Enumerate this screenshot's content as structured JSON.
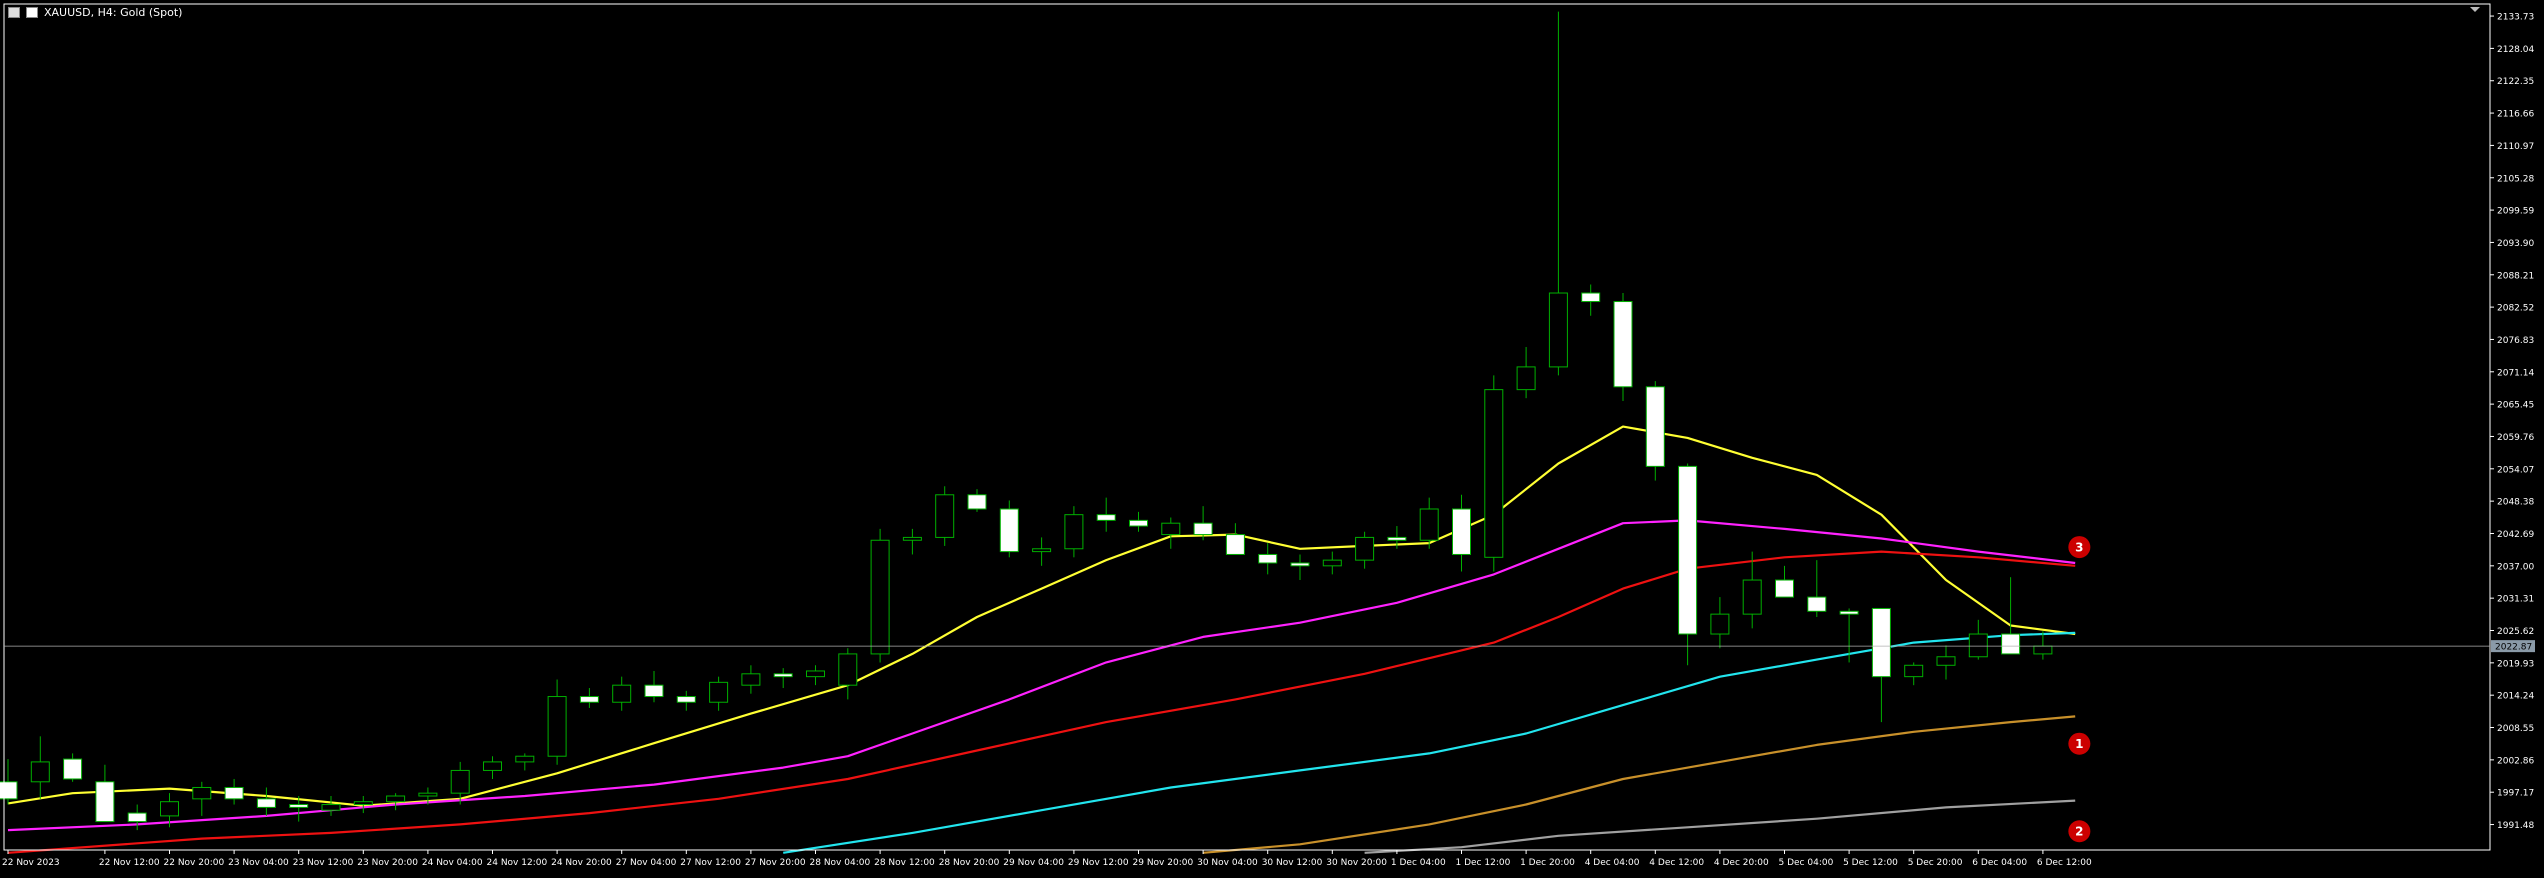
{
  "window": {
    "title": "XAUUSD, H4:  Gold (Spot)"
  },
  "current_price_label": "2022.87",
  "colors": {
    "background": "#000000",
    "axis": "#ffffff",
    "bull_body": "#000000",
    "bull_border": "#00b000",
    "bear_body": "#ffffff",
    "bear_border": "#00b000",
    "ma_yellow": "#ffff33",
    "ma_magenta": "#ff22ff",
    "ma_red": "#ee1111",
    "ma_cyan": "#22e5ee",
    "ma_orange": "#c8902a",
    "ma_gray": "#a0a0a0",
    "current_price_line": "#b0b0b0",
    "current_price_tag": "#8a9aa8",
    "marker": "#cc0000"
  },
  "chart_data": {
    "type": "candlestick",
    "symbol": "XAUUSD",
    "timeframe": "H4",
    "ylim": [
      1987.0,
      2135.5
    ],
    "y_ticks": [
      "2133.73",
      "2128.04",
      "2122.35",
      "2116.66",
      "2110.97",
      "2105.28",
      "2099.59",
      "2093.90",
      "2088.21",
      "2082.52",
      "2076.83",
      "2071.14",
      "2065.45",
      "2059.76",
      "2054.07",
      "2048.38",
      "2042.69",
      "2037.00",
      "2031.31",
      "2025.62",
      "2019.93",
      "2014.24",
      "2008.55",
      "2002.86",
      "1997.17",
      "1991.48"
    ],
    "x_ticks": [
      {
        "label": "22 Nov 2023",
        "idx": 0
      },
      {
        "label": "22 Nov 12:00",
        "idx": 3
      },
      {
        "label": "22 Nov 20:00",
        "idx": 5
      },
      {
        "label": "23 Nov 04:00",
        "idx": 7
      },
      {
        "label": "23 Nov 12:00",
        "idx": 9
      },
      {
        "label": "23 Nov 20:00",
        "idx": 11
      },
      {
        "label": "24 Nov 04:00",
        "idx": 13
      },
      {
        "label": "24 Nov 12:00",
        "idx": 15
      },
      {
        "label": "24 Nov 20:00",
        "idx": 17
      },
      {
        "label": "27 Nov 04:00",
        "idx": 19
      },
      {
        "label": "27 Nov 12:00",
        "idx": 21
      },
      {
        "label": "27 Nov 20:00",
        "idx": 23
      },
      {
        "label": "28 Nov 04:00",
        "idx": 25
      },
      {
        "label": "28 Nov 12:00",
        "idx": 27
      },
      {
        "label": "28 Nov 20:00",
        "idx": 29
      },
      {
        "label": "29 Nov 04:00",
        "idx": 31
      },
      {
        "label": "29 Nov 12:00",
        "idx": 33
      },
      {
        "label": "29 Nov 20:00",
        "idx": 35
      },
      {
        "label": "30 Nov 04:00",
        "idx": 37
      },
      {
        "label": "30 Nov 12:00",
        "idx": 39
      },
      {
        "label": "30 Nov 20:00",
        "idx": 41
      },
      {
        "label": "1 Dec 04:00",
        "idx": 43
      },
      {
        "label": "1 Dec 12:00",
        "idx": 45
      },
      {
        "label": "1 Dec 20:00",
        "idx": 47
      },
      {
        "label": "4 Dec 04:00",
        "idx": 49
      },
      {
        "label": "4 Dec 12:00",
        "idx": 51
      },
      {
        "label": "4 Dec 20:00",
        "idx": 53
      },
      {
        "label": "5 Dec 04:00",
        "idx": 55
      },
      {
        "label": "5 Dec 12:00",
        "idx": 57
      },
      {
        "label": "5 Dec 20:00",
        "idx": 59
      },
      {
        "label": "6 Dec 04:00",
        "idx": 61
      },
      {
        "label": "6 Dec 12:00",
        "idx": 63
      }
    ],
    "candles": [
      [
        1999.0,
        2003.0,
        1995.0,
        1996.0
      ],
      [
        1999.0,
        2007.0,
        1996.0,
        2002.5
      ],
      [
        2003.0,
        2004.0,
        1999.0,
        1999.5
      ],
      [
        1999.0,
        2002.0,
        1993.0,
        1992.0
      ],
      [
        1993.5,
        1995.0,
        1990.5,
        1992.0
      ],
      [
        1993.0,
        1997.0,
        1991.0,
        1995.5
      ],
      [
        1996.0,
        1999.0,
        1993.0,
        1998.0
      ],
      [
        1998.0,
        1999.5,
        1995.0,
        1996.0
      ],
      [
        1996.0,
        1998.0,
        1993.0,
        1994.5
      ],
      [
        1995.0,
        1996.5,
        1992.0,
        1994.5
      ],
      [
        1994.0,
        1996.5,
        1993.0,
        1995.0
      ],
      [
        1995.0,
        1996.5,
        1993.5,
        1995.5
      ],
      [
        1995.5,
        1997.0,
        1994.0,
        1996.5
      ],
      [
        1996.5,
        1998.0,
        1995.0,
        1997.0
      ],
      [
        1997.0,
        2002.5,
        1995.0,
        2001.0
      ],
      [
        2001.0,
        2003.5,
        1999.5,
        2002.5
      ],
      [
        2002.5,
        2004.0,
        2001.0,
        2003.5
      ],
      [
        2003.5,
        2017.0,
        2002.0,
        2014.0
      ],
      [
        2014.0,
        2015.5,
        2012.0,
        2013.0
      ],
      [
        2013.0,
        2017.5,
        2011.5,
        2016.0
      ],
      [
        2016.0,
        2018.5,
        2013.0,
        2014.0
      ],
      [
        2014.0,
        2015.0,
        2011.5,
        2013.0
      ],
      [
        2013.0,
        2017.5,
        2011.5,
        2016.5
      ],
      [
        2016.0,
        2019.5,
        2014.5,
        2018.0
      ],
      [
        2018.0,
        2019.0,
        2015.5,
        2017.5
      ],
      [
        2017.5,
        2019.5,
        2016.0,
        2018.5
      ],
      [
        2016.0,
        2022.5,
        2013.5,
        2021.5
      ],
      [
        2021.5,
        2043.5,
        2020.0,
        2041.5
      ],
      [
        2041.5,
        2043.5,
        2039.0,
        2042.0
      ],
      [
        2042.0,
        2051.0,
        2040.5,
        2049.5
      ],
      [
        2049.5,
        2050.5,
        2046.5,
        2047.0
      ],
      [
        2047.0,
        2048.5,
        2038.5,
        2039.5
      ],
      [
        2039.5,
        2042.0,
        2037.0,
        2040.0
      ],
      [
        2040.0,
        2047.5,
        2038.5,
        2046.0
      ],
      [
        2046.0,
        2049.0,
        2043.0,
        2045.0
      ],
      [
        2045.0,
        2046.5,
        2043.0,
        2044.0
      ],
      [
        2042.5,
        2045.5,
        2040.0,
        2044.5
      ],
      [
        2044.5,
        2047.5,
        2041.5,
        2042.5
      ],
      [
        2042.5,
        2044.5,
        2039.5,
        2039.0
      ],
      [
        2039.0,
        2041.0,
        2035.5,
        2037.5
      ],
      [
        2037.5,
        2039.0,
        2034.5,
        2037.0
      ],
      [
        2037.0,
        2039.5,
        2035.5,
        2038.0
      ],
      [
        2038.0,
        2043.0,
        2036.5,
        2042.0
      ],
      [
        2042.0,
        2044.0,
        2040.0,
        2041.5
      ],
      [
        2041.5,
        2049.0,
        2040.0,
        2047.0
      ],
      [
        2047.0,
        2049.5,
        2036.0,
        2039.0
      ],
      [
        2038.5,
        2070.5,
        2036.0,
        2068.0
      ],
      [
        2068.0,
        2075.5,
        2066.5,
        2072.0
      ],
      [
        2072.0,
        2134.5,
        2070.5,
        2085.0
      ],
      [
        2085.0,
        2086.5,
        2081.0,
        2083.5
      ],
      [
        2083.5,
        2085.0,
        2066.0,
        2068.5
      ],
      [
        2068.5,
        2069.5,
        2052.0,
        2054.5
      ],
      [
        2054.5,
        2055.0,
        2019.5,
        2025.0
      ],
      [
        2025.0,
        2031.5,
        2022.5,
        2028.5
      ],
      [
        2028.5,
        2039.5,
        2026.0,
        2034.5
      ],
      [
        2034.5,
        2037.0,
        2031.5,
        2031.5
      ],
      [
        2031.5,
        2038.0,
        2028.0,
        2029.0
      ],
      [
        2029.0,
        2029.5,
        2020.0,
        2028.5
      ],
      [
        2029.5,
        2029.5,
        2009.5,
        2017.5
      ],
      [
        2017.5,
        2020.0,
        2016.0,
        2019.5
      ],
      [
        2019.5,
        2023.0,
        2017.0,
        2021.0
      ],
      [
        2021.0,
        2027.5,
        2020.5,
        2025.0
      ],
      [
        2025.0,
        2035.0,
        2021.5,
        2021.5
      ],
      [
        2021.5,
        2025.5,
        2020.5,
        2022.87
      ]
    ],
    "moving_averages": [
      {
        "color": "#ffff33",
        "values": [
          [
            0,
            1995.2
          ],
          [
            2,
            1997.0
          ],
          [
            5,
            1997.8
          ],
          [
            8,
            1996.5
          ],
          [
            11,
            1994.8
          ],
          [
            14,
            1996.0
          ],
          [
            17,
            2000.5
          ],
          [
            20,
            2005.8
          ],
          [
            23,
            2011.0
          ],
          [
            26,
            2016.0
          ],
          [
            28,
            2021.5
          ],
          [
            30,
            2028.0
          ],
          [
            32,
            2033.0
          ],
          [
            34,
            2038.0
          ],
          [
            36,
            2042.2
          ],
          [
            38,
            2042.5
          ],
          [
            40,
            2040.0
          ],
          [
            42,
            2040.5
          ],
          [
            44,
            2041.0
          ],
          [
            46,
            2046.0
          ],
          [
            48,
            2055.0
          ],
          [
            50,
            2061.5
          ],
          [
            52,
            2059.5
          ],
          [
            54,
            2056.0
          ],
          [
            56,
            2053.0
          ],
          [
            58,
            2046.0
          ],
          [
            60,
            2034.5
          ],
          [
            62,
            2026.5
          ],
          [
            64,
            2025.0
          ]
        ]
      },
      {
        "color": "#ff22ff",
        "values": [
          [
            0,
            1990.5
          ],
          [
            4,
            1991.5
          ],
          [
            8,
            1993.0
          ],
          [
            12,
            1995.0
          ],
          [
            16,
            1996.5
          ],
          [
            20,
            1998.5
          ],
          [
            24,
            2001.5
          ],
          [
            26,
            2003.5
          ],
          [
            28,
            2007.5
          ],
          [
            31,
            2013.5
          ],
          [
            34,
            2020.0
          ],
          [
            37,
            2024.5
          ],
          [
            40,
            2027.0
          ],
          [
            43,
            2030.5
          ],
          [
            46,
            2035.5
          ],
          [
            48,
            2040.0
          ],
          [
            50,
            2044.5
          ],
          [
            52,
            2045.0
          ],
          [
            55,
            2043.5
          ],
          [
            58,
            2041.8
          ],
          [
            61,
            2039.5
          ],
          [
            64,
            2037.5
          ]
        ]
      },
      {
        "color": "#ee1111",
        "values": [
          [
            0,
            1986.5
          ],
          [
            6,
            1989.0
          ],
          [
            10,
            1990.0
          ],
          [
            14,
            1991.5
          ],
          [
            18,
            1993.5
          ],
          [
            22,
            1996.0
          ],
          [
            26,
            1999.5
          ],
          [
            30,
            2004.5
          ],
          [
            34,
            2009.5
          ],
          [
            38,
            2013.5
          ],
          [
            42,
            2018.0
          ],
          [
            46,
            2023.5
          ],
          [
            48,
            2028.0
          ],
          [
            50,
            2033.0
          ],
          [
            52,
            2036.5
          ],
          [
            55,
            2038.5
          ],
          [
            58,
            2039.5
          ],
          [
            61,
            2038.5
          ],
          [
            64,
            2037.0
          ]
        ]
      },
      {
        "color": "#22e5ee",
        "values": [
          [
            24,
            1986.5
          ],
          [
            28,
            1990.0
          ],
          [
            32,
            1994.0
          ],
          [
            36,
            1998.0
          ],
          [
            40,
            2001.0
          ],
          [
            44,
            2004.0
          ],
          [
            47,
            2007.5
          ],
          [
            50,
            2012.5
          ],
          [
            53,
            2017.5
          ],
          [
            56,
            2020.5
          ],
          [
            59,
            2023.5
          ],
          [
            62,
            2024.8
          ],
          [
            64,
            2025.2
          ]
        ]
      },
      {
        "color": "#c8902a",
        "values": [
          [
            37,
            1986.5
          ],
          [
            40,
            1988.0
          ],
          [
            44,
            1991.5
          ],
          [
            47,
            1995.0
          ],
          [
            50,
            1999.5
          ],
          [
            53,
            2002.5
          ],
          [
            56,
            2005.5
          ],
          [
            59,
            2007.8
          ],
          [
            62,
            2009.5
          ],
          [
            64,
            2010.5
          ]
        ]
      },
      {
        "color": "#a0a0a0",
        "values": [
          [
            42,
            1986.5
          ],
          [
            45,
            1987.5
          ],
          [
            48,
            1989.5
          ],
          [
            52,
            1991.0
          ],
          [
            56,
            1992.5
          ],
          [
            60,
            1994.5
          ],
          [
            64,
            1995.7
          ]
        ]
      }
    ],
    "current_price": 2022.87,
    "markers": [
      {
        "label": "3",
        "idx": 63.2,
        "price": 2040.3
      },
      {
        "label": "1",
        "idx": 63.2,
        "price": 2005.7
      },
      {
        "label": "2",
        "idx": 63.2,
        "price": 1990.3
      }
    ]
  }
}
